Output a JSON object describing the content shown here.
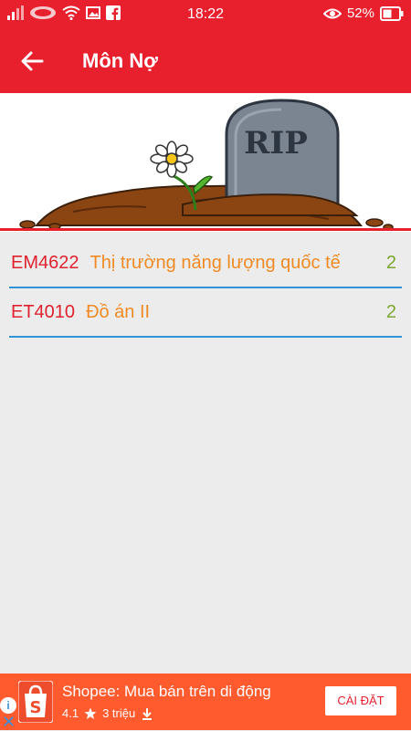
{
  "status_bar": {
    "time": "18:22",
    "battery_percent": "52%",
    "icons_left": [
      "signal-icon",
      "carrier-logo-icon",
      "wifi-icon",
      "image-icon",
      "facebook-icon"
    ],
    "icons_right": [
      "eye-icon",
      "battery-icon"
    ]
  },
  "app_bar": {
    "title": "Môn Nợ",
    "back_icon": "arrow-left-icon"
  },
  "banner": {
    "tombstone_text": "RIP"
  },
  "subjects": [
    {
      "code": "EM4622",
      "name": "Thị trường năng lượng quốc tế",
      "credits": "2"
    },
    {
      "code": "ET4010",
      "name": "Đồ án II",
      "credits": "2"
    }
  ],
  "ad": {
    "title": "Shopee: Mua bán trên di động",
    "rating": "4.1",
    "downloads": "3 triệu",
    "install_label": "CÀI ĐẶT",
    "info_label": "i",
    "close_label": "✕"
  },
  "colors": {
    "primary": "#e8202e",
    "code": "#e0222f",
    "name": "#f08a24",
    "credits": "#7aa62e",
    "divider": "#2f93d6",
    "ad_bg": "#ff5b2e"
  }
}
